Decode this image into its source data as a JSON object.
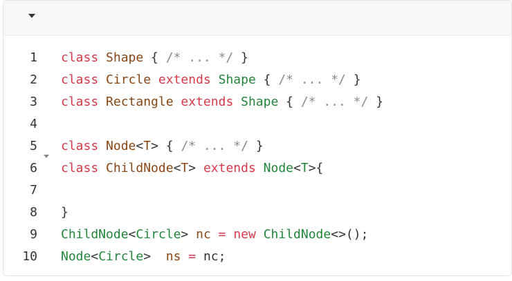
{
  "editor": {
    "toolbar": {
      "dropdown_icon": "caret-down-icon"
    },
    "lines": [
      {
        "number": "1",
        "fold": false,
        "tokens": [
          {
            "text": "class",
            "kind": "keyword"
          },
          {
            "text": " ",
            "kind": "plain"
          },
          {
            "text": "Shape",
            "kind": "class"
          },
          {
            "text": " { ",
            "kind": "plain"
          },
          {
            "text": "/* ... */",
            "kind": "comment"
          },
          {
            "text": " }",
            "kind": "plain"
          }
        ]
      },
      {
        "number": "2",
        "fold": false,
        "tokens": [
          {
            "text": "class",
            "kind": "keyword"
          },
          {
            "text": " ",
            "kind": "plain"
          },
          {
            "text": "Circle",
            "kind": "class"
          },
          {
            "text": " ",
            "kind": "plain"
          },
          {
            "text": "extends",
            "kind": "keyword"
          },
          {
            "text": " ",
            "kind": "plain"
          },
          {
            "text": "Shape",
            "kind": "type"
          },
          {
            "text": " { ",
            "kind": "plain"
          },
          {
            "text": "/* ... */",
            "kind": "comment"
          },
          {
            "text": " }",
            "kind": "plain"
          }
        ]
      },
      {
        "number": "3",
        "fold": false,
        "tokens": [
          {
            "text": "class",
            "kind": "keyword"
          },
          {
            "text": " ",
            "kind": "plain"
          },
          {
            "text": "Rectangle",
            "kind": "class"
          },
          {
            "text": " ",
            "kind": "plain"
          },
          {
            "text": "extends",
            "kind": "keyword"
          },
          {
            "text": " ",
            "kind": "plain"
          },
          {
            "text": "Shape",
            "kind": "type"
          },
          {
            "text": " { ",
            "kind": "plain"
          },
          {
            "text": "/* ... */",
            "kind": "comment"
          },
          {
            "text": " }",
            "kind": "plain"
          }
        ]
      },
      {
        "number": "4",
        "fold": false,
        "tokens": []
      },
      {
        "number": "5",
        "fold": false,
        "tokens": [
          {
            "text": "class",
            "kind": "keyword"
          },
          {
            "text": " ",
            "kind": "plain"
          },
          {
            "text": "Node",
            "kind": "class"
          },
          {
            "text": "<",
            "kind": "plain"
          },
          {
            "text": "T",
            "kind": "class"
          },
          {
            "text": "> { ",
            "kind": "plain"
          },
          {
            "text": "/* ... */",
            "kind": "comment"
          },
          {
            "text": " }",
            "kind": "plain"
          }
        ]
      },
      {
        "number": "6",
        "fold": true,
        "tokens": [
          {
            "text": "class",
            "kind": "keyword"
          },
          {
            "text": " ",
            "kind": "plain"
          },
          {
            "text": "ChildNode",
            "kind": "class"
          },
          {
            "text": "<",
            "kind": "plain"
          },
          {
            "text": "T",
            "kind": "class"
          },
          {
            "text": "> ",
            "kind": "plain"
          },
          {
            "text": "extends",
            "kind": "keyword"
          },
          {
            "text": " ",
            "kind": "plain"
          },
          {
            "text": "Node",
            "kind": "type"
          },
          {
            "text": "<",
            "kind": "plain"
          },
          {
            "text": "T",
            "kind": "type"
          },
          {
            "text": ">{",
            "kind": "plain"
          }
        ]
      },
      {
        "number": "7",
        "fold": false,
        "tokens": []
      },
      {
        "number": "8",
        "fold": false,
        "tokens": [
          {
            "text": "}",
            "kind": "plain"
          }
        ]
      },
      {
        "number": "9",
        "fold": false,
        "tokens": [
          {
            "text": "ChildNode",
            "kind": "type"
          },
          {
            "text": "<",
            "kind": "plain"
          },
          {
            "text": "Circle",
            "kind": "type"
          },
          {
            "text": "> ",
            "kind": "plain"
          },
          {
            "text": "nc",
            "kind": "variable"
          },
          {
            "text": " ",
            "kind": "plain"
          },
          {
            "text": "=",
            "kind": "keyword"
          },
          {
            "text": " ",
            "kind": "plain"
          },
          {
            "text": "new",
            "kind": "keyword"
          },
          {
            "text": " ",
            "kind": "plain"
          },
          {
            "text": "ChildNode",
            "kind": "type"
          },
          {
            "text": "<>();",
            "kind": "plain"
          }
        ]
      },
      {
        "number": "10",
        "fold": false,
        "tokens": [
          {
            "text": "Node",
            "kind": "type"
          },
          {
            "text": "<",
            "kind": "plain"
          },
          {
            "text": "Circle",
            "kind": "type"
          },
          {
            "text": ">  ",
            "kind": "plain"
          },
          {
            "text": "ns",
            "kind": "variable"
          },
          {
            "text": " ",
            "kind": "plain"
          },
          {
            "text": "=",
            "kind": "keyword"
          },
          {
            "text": " nc;",
            "kind": "plain"
          }
        ]
      }
    ]
  },
  "colors": {
    "keyword": "#d73a49",
    "type": "#22863a",
    "class": "#8b4513",
    "comment": "#8a8a8a",
    "plain": "#333333",
    "variable": "#8b4513"
  }
}
